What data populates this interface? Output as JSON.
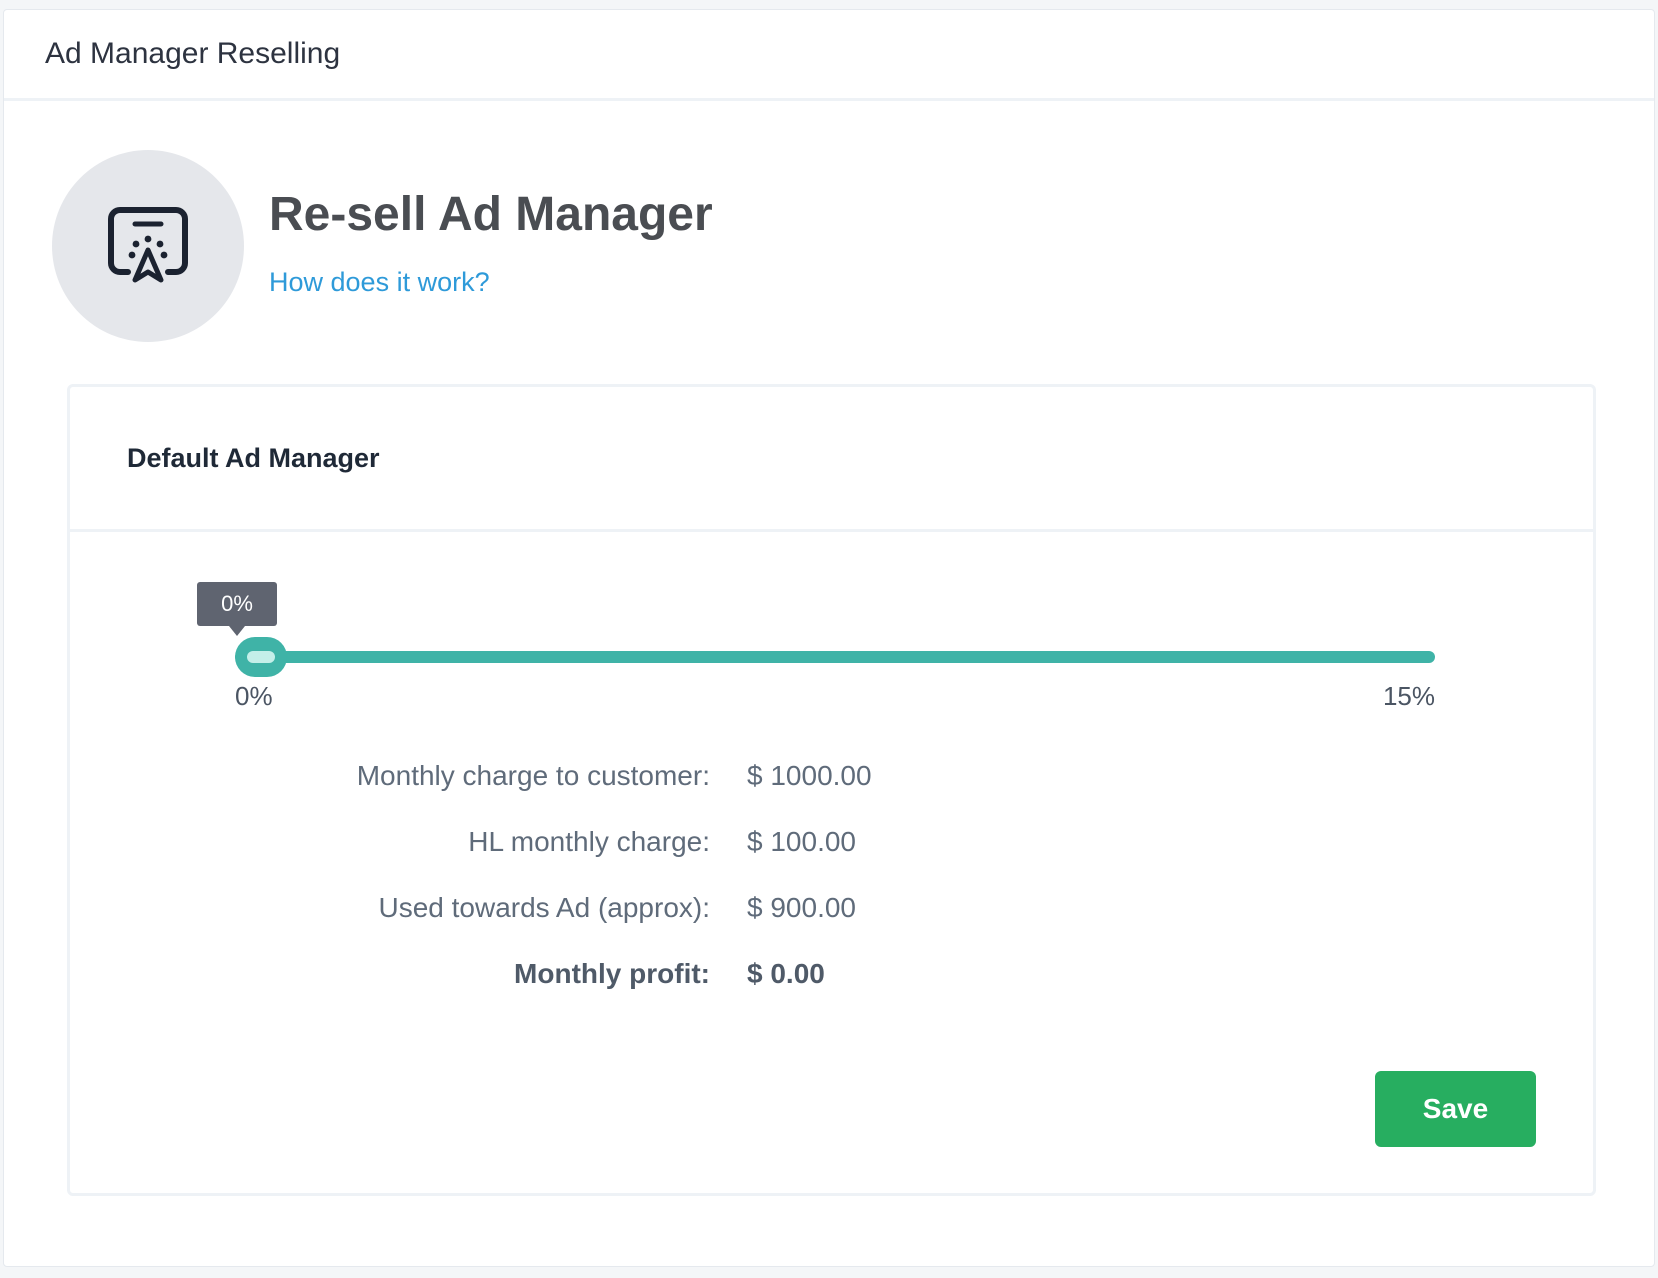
{
  "panel": {
    "title": "Ad Manager Reselling"
  },
  "hero": {
    "icon": "ad-manager-icon",
    "title": "Re-sell Ad Manager",
    "link": "How does it work?"
  },
  "card": {
    "title": "Default Ad Manager",
    "slider": {
      "value": 0,
      "min": 0,
      "max": 15,
      "tooltip": "0%",
      "min_label": "0%",
      "max_label": "15%",
      "accent_color": "#3fb3a7"
    },
    "rows": [
      {
        "label": "Monthly charge to customer:",
        "value": "$ 1000.00"
      },
      {
        "label": "HL monthly charge:",
        "value": "$ 100.00"
      },
      {
        "label": "Used towards Ad (approx):",
        "value": "$ 900.00"
      },
      {
        "label": "Monthly profit:",
        "value": "$ 0.00"
      }
    ],
    "save_label": "Save",
    "save_color": "#27ae60"
  },
  "colors": {
    "link": "#2e9ad9",
    "tooltip_bg": "#5f6470",
    "avatar_bg": "#e5e7eb"
  }
}
